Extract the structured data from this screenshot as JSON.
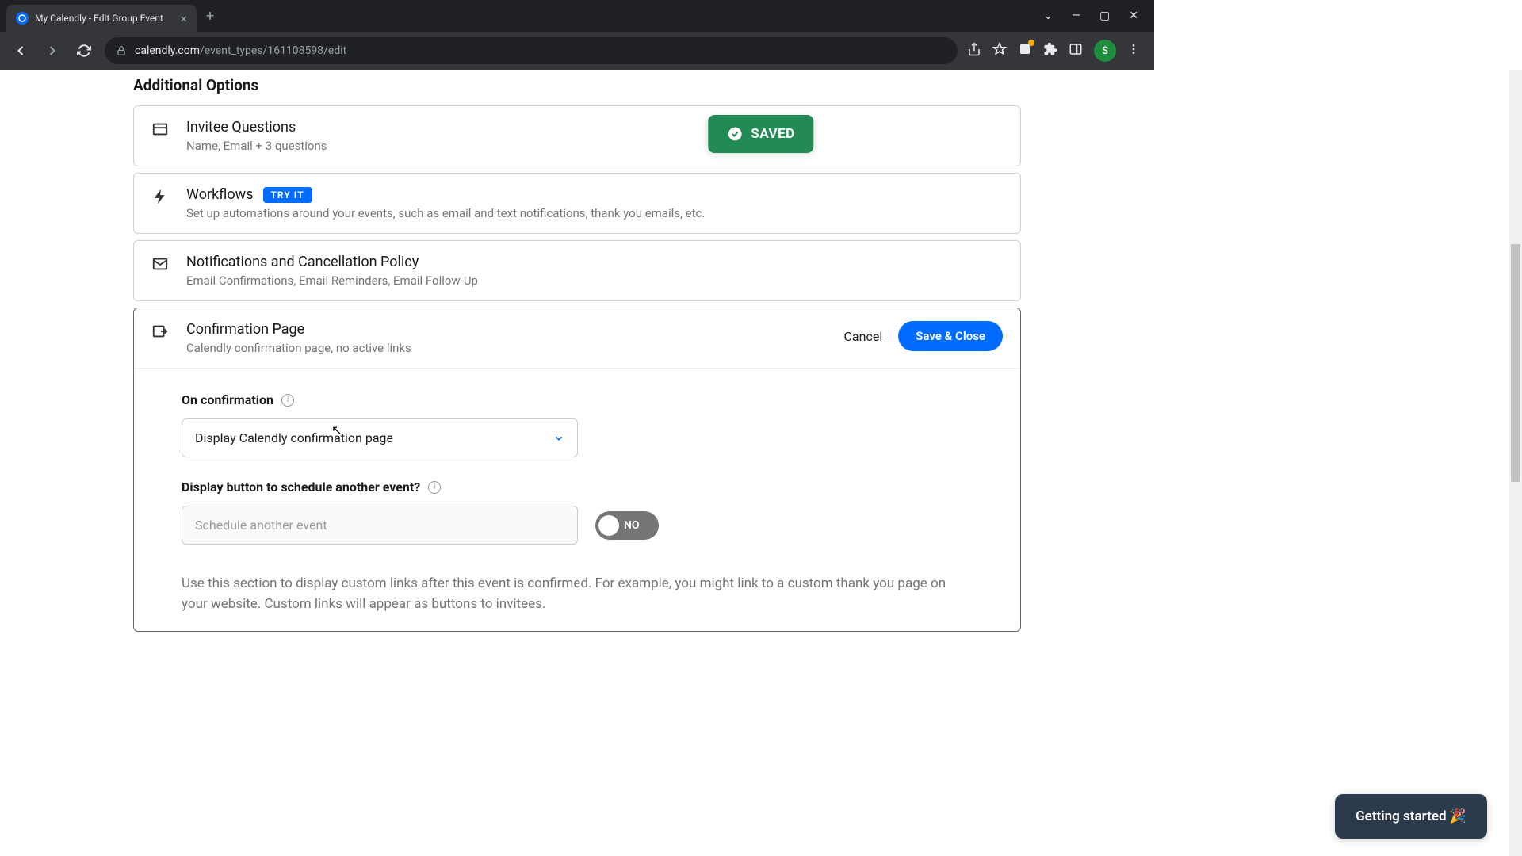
{
  "browser": {
    "tab_title": "My Calendly - Edit Group Event",
    "url_host": "calendly.com",
    "url_path": "/event_types/161108598/edit",
    "avatar_letter": "S"
  },
  "toast": {
    "label": "SAVED"
  },
  "page": {
    "section_title": "Additional Options",
    "cards": {
      "invitee": {
        "title": "Invitee Questions",
        "sub": "Name, Email + 3 questions"
      },
      "workflows": {
        "title": "Workflows",
        "badge": "TRY IT",
        "sub": "Set up automations around your events, such as email and text notifications, thank you emails, etc."
      },
      "notifications": {
        "title": "Notifications and Cancellation Policy",
        "sub": "Email Confirmations, Email Reminders, Email Follow-Up"
      },
      "confirmation": {
        "title": "Confirmation Page",
        "sub": "Calendly confirmation page, no active links",
        "cancel": "Cancel",
        "save": "Save & Close",
        "on_confirmation_label": "On confirmation",
        "select_value": "Display Calendly confirmation page",
        "display_button_label": "Display button to schedule another event?",
        "input_placeholder": "Schedule another event",
        "toggle_label": "NO",
        "help_text": "Use this section to display custom links after this event is confirmed. For example, you might link to a custom thank you page on your website. Custom links will appear as buttons to invitees."
      }
    }
  },
  "widget": {
    "label": "Getting started 🎉"
  }
}
